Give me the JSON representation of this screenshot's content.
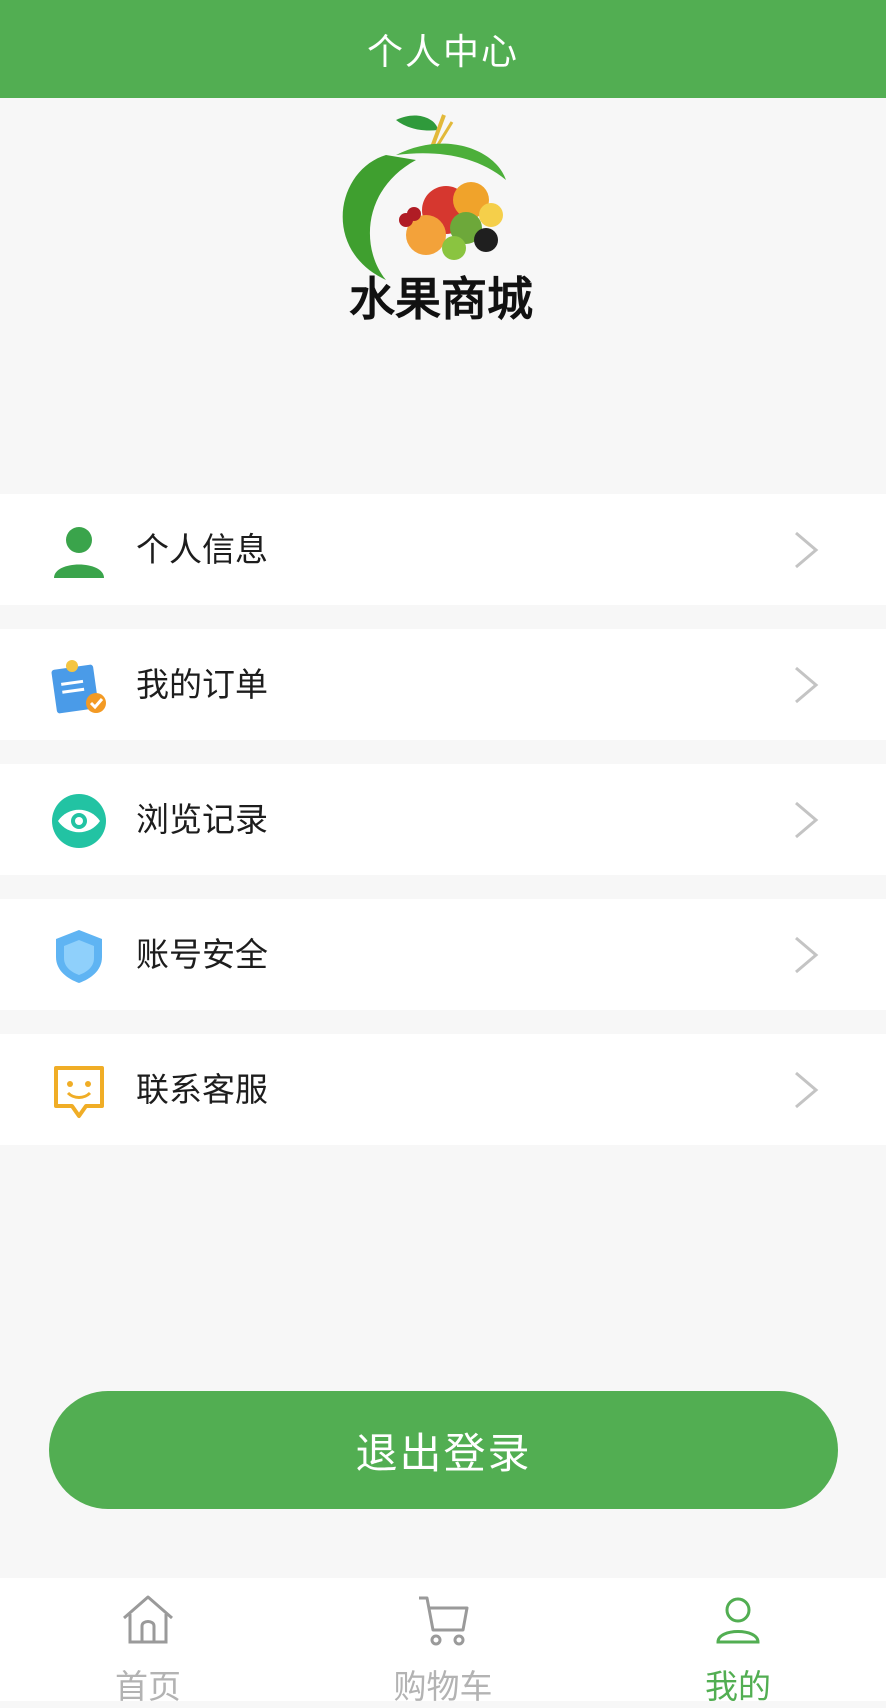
{
  "header": {
    "title": "个人中心"
  },
  "logo": {
    "text": "水果商城"
  },
  "menu": {
    "items": [
      {
        "label": "个人信息",
        "icon": "user-icon"
      },
      {
        "label": "我的订单",
        "icon": "order-icon"
      },
      {
        "label": "浏览记录",
        "icon": "eye-icon"
      },
      {
        "label": "账号安全",
        "icon": "shield-icon"
      },
      {
        "label": "联系客服",
        "icon": "customer-service-icon"
      }
    ]
  },
  "logout": {
    "label": "退出登录"
  },
  "tabbar": {
    "tabs": [
      {
        "label": "首页",
        "icon": "home-icon",
        "active": false
      },
      {
        "label": "购物车",
        "icon": "cart-icon",
        "active": false
      },
      {
        "label": "我的",
        "icon": "profile-icon",
        "active": true
      }
    ]
  },
  "colors": {
    "brand_green": "#52ae52",
    "inactive_gray": "#b3b3b3",
    "background": "#f7f7f7"
  }
}
